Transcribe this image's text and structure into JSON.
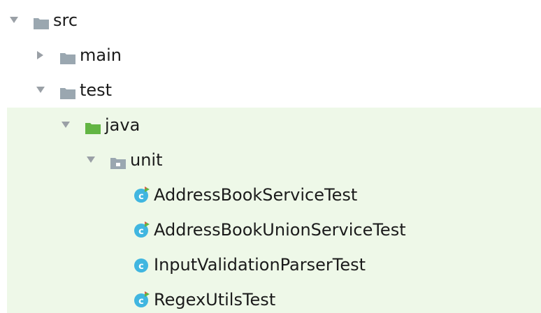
{
  "tree": {
    "src": {
      "label": "src",
      "expanded": true,
      "icon": "folder-icon"
    },
    "main": {
      "label": "main",
      "expanded": false,
      "icon": "folder-icon"
    },
    "test": {
      "label": "test",
      "expanded": true,
      "icon": "folder-icon"
    },
    "java": {
      "label": "java",
      "expanded": true,
      "icon": "test-source-root-folder-icon"
    },
    "unit": {
      "label": "unit",
      "expanded": true,
      "icon": "package-folder-icon"
    },
    "files": [
      {
        "label": "AddressBookServiceTest",
        "icon": "test-class-icon"
      },
      {
        "label": "AddressBookUnionServiceTest",
        "icon": "test-class-icon"
      },
      {
        "label": "InputValidationParserTest",
        "icon": "class-icon"
      },
      {
        "label": "RegexUtilsTest",
        "icon": "test-class-icon"
      }
    ]
  },
  "colors": {
    "folder": "#9aa7b0",
    "test_source_folder": "#62b543",
    "class_icon": "#40b6e0",
    "test_marker_red": "#e05a4a",
    "test_marker_green": "#62b543",
    "selection_background": "#eef8e8",
    "arrow": "#9aa0a6"
  }
}
